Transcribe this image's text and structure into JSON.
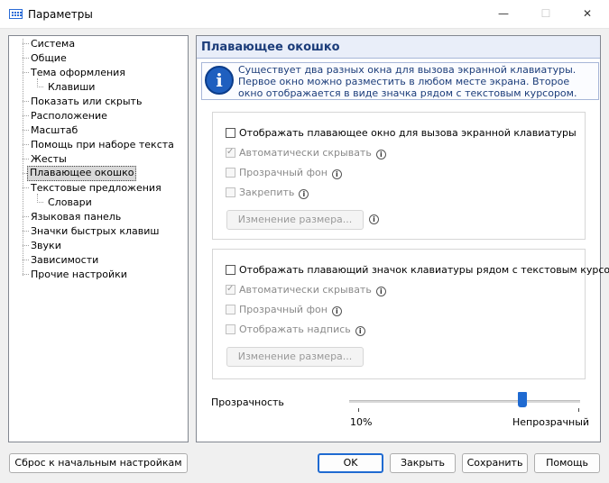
{
  "window": {
    "title": "Параметры",
    "controls": {
      "minimize": "—",
      "maximize": "☐",
      "close": "✕"
    }
  },
  "tree": {
    "items": [
      {
        "label": "Система",
        "level": 0
      },
      {
        "label": "Общие",
        "level": 0
      },
      {
        "label": "Тема оформления",
        "level": 0
      },
      {
        "label": "Клавиши",
        "level": 1
      },
      {
        "label": "Показать или скрыть",
        "level": 0
      },
      {
        "label": "Расположение",
        "level": 0
      },
      {
        "label": "Масштаб",
        "level": 0
      },
      {
        "label": "Помощь при наборе текста",
        "level": 0
      },
      {
        "label": "Жесты",
        "level": 0
      },
      {
        "label": "Плавающее окошко",
        "level": 0,
        "selected": true
      },
      {
        "label": "Текстовые предложения",
        "level": 0
      },
      {
        "label": "Словари",
        "level": 1
      },
      {
        "label": "Языковая панель",
        "level": 0
      },
      {
        "label": "Значки быстрых клавиш",
        "level": 0
      },
      {
        "label": "Звуки",
        "level": 0
      },
      {
        "label": "Зависимости",
        "level": 0
      },
      {
        "label": "Прочие настройки",
        "level": 0
      }
    ]
  },
  "panel": {
    "title": "Плавающее окошко",
    "info_icon": "info-circle-icon",
    "info_text": "Существует два разных окна для вызова экранной клавиатуры. Первое окно можно разместить в любом месте экрана. Второе окно отображается в виде значка рядом с текстовым курсором.",
    "group1": {
      "main": {
        "label": "Отображать плавающее окно для вызова экранной клавиатуры",
        "checked": false
      },
      "options": [
        {
          "label": "Автоматически скрывать",
          "checked": true
        },
        {
          "label": "Прозрачный фон",
          "checked": false
        },
        {
          "label": "Закрепить",
          "checked": false
        }
      ],
      "resize_button": "Изменение размера..."
    },
    "group2": {
      "main": {
        "label": "Отображать плавающий значок клавиатуры рядом с текстовым курсором",
        "checked": false
      },
      "options": [
        {
          "label": "Автоматически скрывать",
          "checked": true
        },
        {
          "label": "Прозрачный фон",
          "checked": false
        },
        {
          "label": "Отображать надпись",
          "checked": false
        }
      ],
      "resize_button": "Изменение размера..."
    },
    "transparency": {
      "label": "Прозрачность",
      "min_label": "10%",
      "max_label": "Непрозрачный",
      "value_fraction": 0.76
    }
  },
  "footer": {
    "reset": "Сброс к начальным настройкам",
    "ok": "OK",
    "close": "Закрыть",
    "save": "Сохранить",
    "help": "Помощь"
  },
  "colors": {
    "accent": "#1f6ad1",
    "panel_header": "#e9eef9",
    "title_text": "#1c3d7a"
  }
}
